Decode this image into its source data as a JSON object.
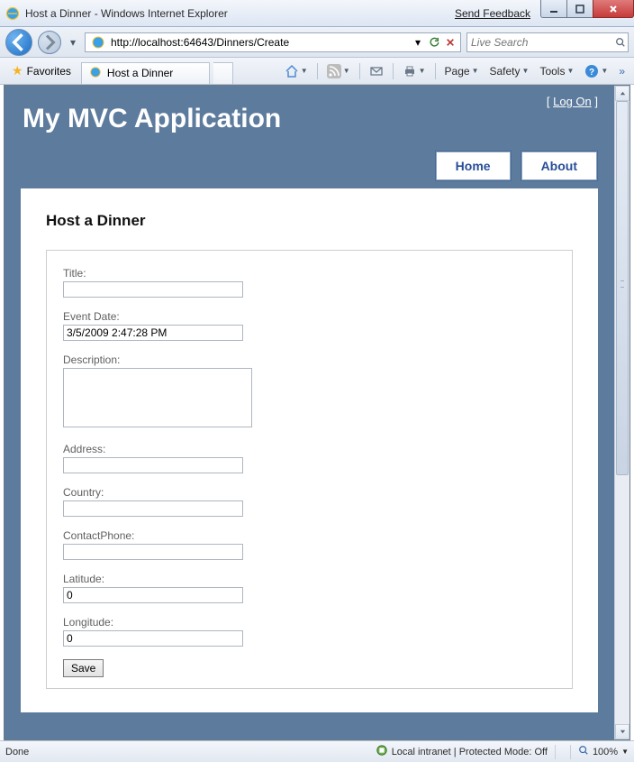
{
  "window": {
    "title": "Host a Dinner - Windows Internet Explorer",
    "feedback_link": "Send Feedback"
  },
  "address_bar": {
    "url": "http://localhost:64643/Dinners/Create"
  },
  "search": {
    "placeholder": "Live Search"
  },
  "favorites": {
    "label": "Favorites"
  },
  "tab": {
    "title": "Host a Dinner"
  },
  "toolbar_menus": {
    "page": "Page",
    "safety": "Safety",
    "tools": "Tools"
  },
  "app": {
    "title": "My MVC Application",
    "logon_label": "Log On",
    "nav": {
      "home": "Home",
      "about": "About"
    }
  },
  "form": {
    "heading": "Host a Dinner",
    "labels": {
      "title": "Title:",
      "event_date": "Event Date:",
      "description": "Description:",
      "address": "Address:",
      "country": "Country:",
      "contact_phone": "ContactPhone:",
      "latitude": "Latitude:",
      "longitude": "Longitude:"
    },
    "values": {
      "title": "",
      "event_date": "3/5/2009 2:47:28 PM",
      "description": "",
      "address": "",
      "country": "",
      "contact_phone": "",
      "latitude": "0",
      "longitude": "0"
    },
    "save_label": "Save"
  },
  "status": {
    "done": "Done",
    "zone": "Local intranet | Protected Mode: Off",
    "zoom": "100%"
  }
}
